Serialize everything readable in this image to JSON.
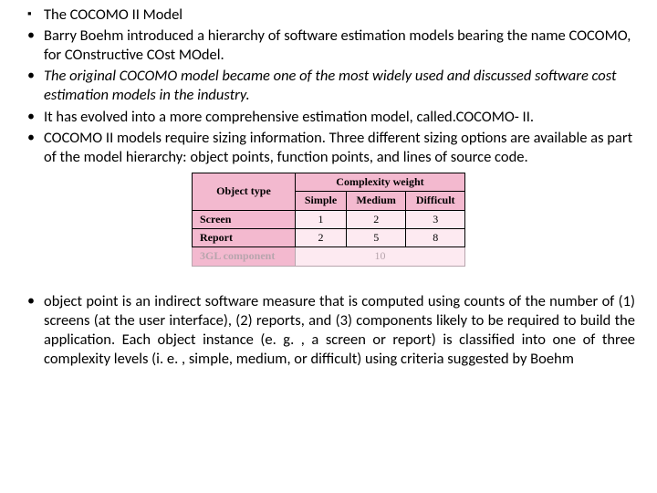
{
  "bullets": [
    " The COCOMO II Model",
    "Barry Boehm  introduced a hierarchy of software estimation models bearing the name COCOMO, for  COnstructive COst MOdel.",
    "The original COCOMO model became one of the most widely used and discussed software cost estimation models in the industry.",
    " It has evolved into a more comprehensive estimation model, called.COCOMO- II.",
    " COCOMO II models require sizing information. Three different sizing options are available as part of the model hierarchy: object points, function points, and lines of source code."
  ],
  "table": {
    "header_row1": [
      "Object type",
      "Complexity weight"
    ],
    "header_row2": [
      "Simple",
      "Medium",
      "Difficult"
    ],
    "rows": [
      {
        "label": "Screen",
        "values": [
          "1",
          "2",
          "3"
        ]
      },
      {
        "label": "Report",
        "values": [
          "2",
          "5",
          "8"
        ]
      }
    ],
    "last_row": {
      "label": "3GL component",
      "value": "10"
    }
  },
  "paragraph": " object point is an indirect software measure that is computed using counts of the number of (1) screens (at the user interface), (2) reports, and (3) components likely to be required to build the application. Each object instance (e. g. , a screen or report) is classified into one of three complexity levels (i. e. , simple, medium, or difficult) using criteria suggested by Boehm"
}
